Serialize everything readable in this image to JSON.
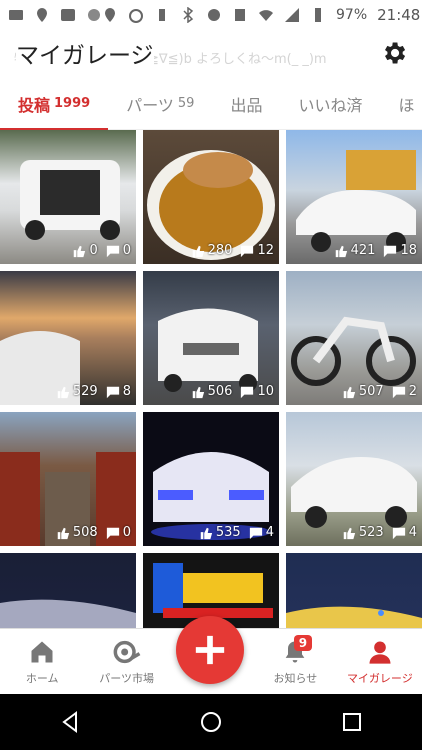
{
  "status_bar": {
    "battery": "97%",
    "time": "21:48"
  },
  "header": {
    "title": "マイガレージ",
    "ghost_text": "特にありませんでした(≧∇≦)b よろしくね〜m(_ _)m"
  },
  "tabs": [
    {
      "label": "投稿",
      "count": "1999"
    },
    {
      "label": "パーツ",
      "count": "59"
    },
    {
      "label": "出品",
      "count": ""
    },
    {
      "label": "いいね済",
      "count": ""
    },
    {
      "label": "ほ",
      "count": ""
    }
  ],
  "posts": [
    {
      "likes": "0",
      "comments": "0"
    },
    {
      "likes": "280",
      "comments": "12"
    },
    {
      "likes": "421",
      "comments": "18"
    },
    {
      "likes": "529",
      "comments": "8"
    },
    {
      "likes": "506",
      "comments": "10"
    },
    {
      "likes": "507",
      "comments": "2"
    },
    {
      "likes": "508",
      "comments": "0"
    },
    {
      "likes": "535",
      "comments": "4"
    },
    {
      "likes": "523",
      "comments": "4"
    }
  ],
  "bottom_nav": {
    "home": "ホーム",
    "parts_market": "パーツ市場",
    "notifications": "お知らせ",
    "notifications_badge": "9",
    "my_garage": "マイガレージ"
  }
}
